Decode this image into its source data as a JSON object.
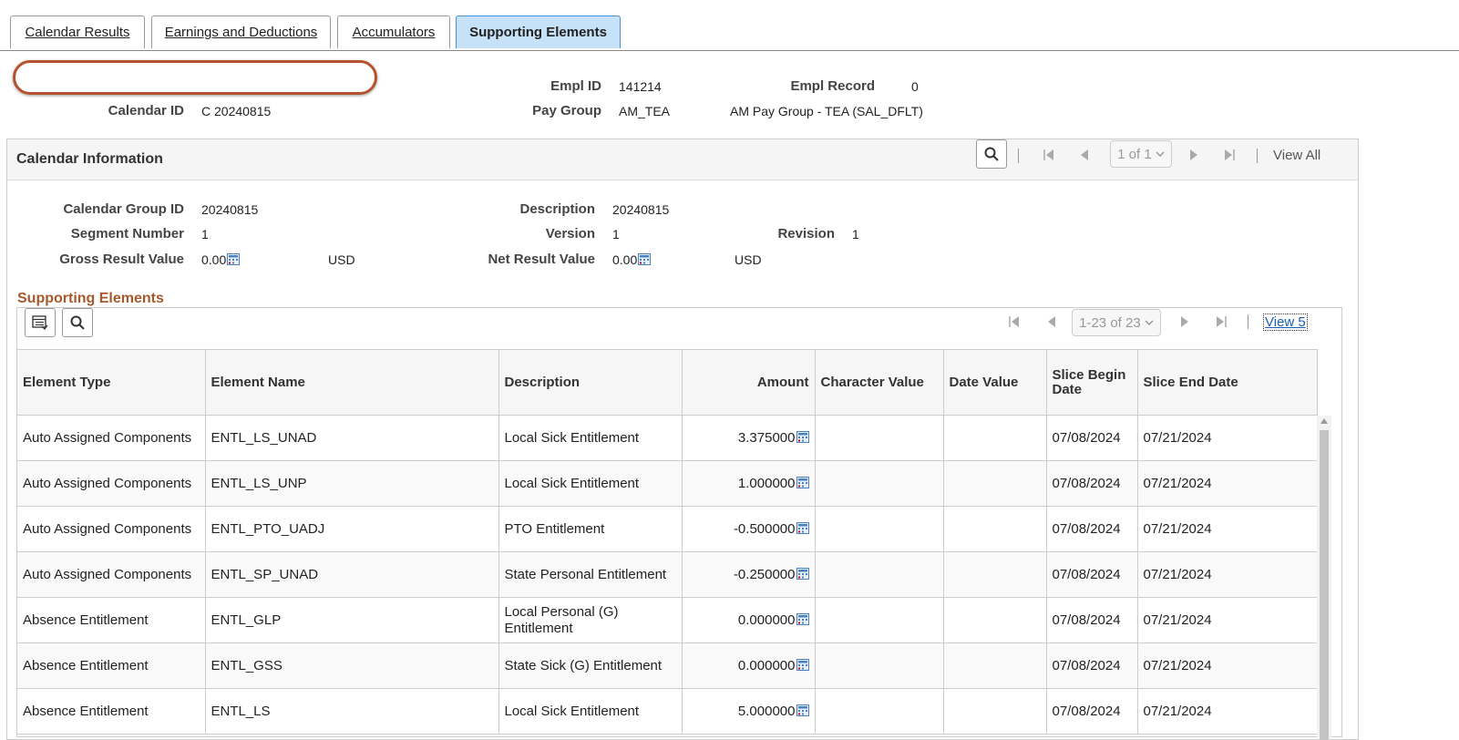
{
  "tabs": [
    {
      "label": "Calendar Results"
    },
    {
      "label": "Earnings and Deductions"
    },
    {
      "label": "Accumulators"
    },
    {
      "label": "Supporting Elements"
    }
  ],
  "header": {
    "empl_id_label": "Empl ID",
    "empl_id": "141214",
    "empl_record_label": "Empl Record",
    "empl_record": "0",
    "calendar_id_label": "Calendar ID",
    "calendar_id": "C 20240815",
    "pay_group_label": "Pay Group",
    "pay_group": "AM_TEA",
    "pay_group_desc": "AM Pay Group - TEA (SAL_DFLT)"
  },
  "calendar_info": {
    "title": "Calendar Information",
    "pager": "1 of 1",
    "view_all": "View All",
    "calendar_group_id_label": "Calendar Group ID",
    "calendar_group_id": "20240815",
    "description_label": "Description",
    "description": "20240815",
    "segment_number_label": "Segment Number",
    "segment_number": "1",
    "version_label": "Version",
    "version": "1",
    "revision_label": "Revision",
    "revision": "1",
    "gross_label": "Gross Result Value",
    "gross_value": "0.00",
    "gross_currency": "USD",
    "net_label": "Net Result Value",
    "net_value": "0.00",
    "net_currency": "USD"
  },
  "supporting": {
    "title": "Supporting Elements",
    "pager": "1-23 of 23",
    "view_link": "View 5",
    "columns": [
      "Element Type",
      "Element Name",
      "Description",
      "Amount",
      "Character Value",
      "Date Value",
      "Slice Begin Date",
      "Slice End Date"
    ],
    "rows": [
      {
        "type": "Auto Assigned Components",
        "name": "ENTL_LS_UNAD",
        "desc": "Local Sick Entitlement",
        "amount": "3.375000",
        "char": "",
        "date": "",
        "begin": "07/08/2024",
        "end": "07/21/2024"
      },
      {
        "type": "Auto Assigned Components",
        "name": "ENTL_LS_UNP",
        "desc": "Local Sick Entitlement",
        "amount": "1.000000",
        "char": "",
        "date": "",
        "begin": "07/08/2024",
        "end": "07/21/2024"
      },
      {
        "type": "Auto Assigned Components",
        "name": "ENTL_PTO_UADJ",
        "desc": "PTO Entitlement",
        "amount": "-0.500000",
        "char": "",
        "date": "",
        "begin": "07/08/2024",
        "end": "07/21/2024"
      },
      {
        "type": "Auto Assigned Components",
        "name": "ENTL_SP_UNAD",
        "desc": "State Personal Entitlement",
        "amount": "-0.250000",
        "char": "",
        "date": "",
        "begin": "07/08/2024",
        "end": "07/21/2024"
      },
      {
        "type": "Absence Entitlement",
        "name": "ENTL_GLP",
        "desc": "Local Personal (G) Entitlement",
        "amount": "0.000000",
        "char": "",
        "date": "",
        "begin": "07/08/2024",
        "end": "07/21/2024"
      },
      {
        "type": "Absence Entitlement",
        "name": "ENTL_GSS",
        "desc": "State Sick (G) Entitlement",
        "amount": "0.000000",
        "char": "",
        "date": "",
        "begin": "07/08/2024",
        "end": "07/21/2024"
      },
      {
        "type": "Absence Entitlement",
        "name": "ENTL_LS",
        "desc": "Local Sick Entitlement",
        "amount": "5.000000",
        "char": "",
        "date": "",
        "begin": "07/08/2024",
        "end": "07/21/2024"
      }
    ]
  }
}
